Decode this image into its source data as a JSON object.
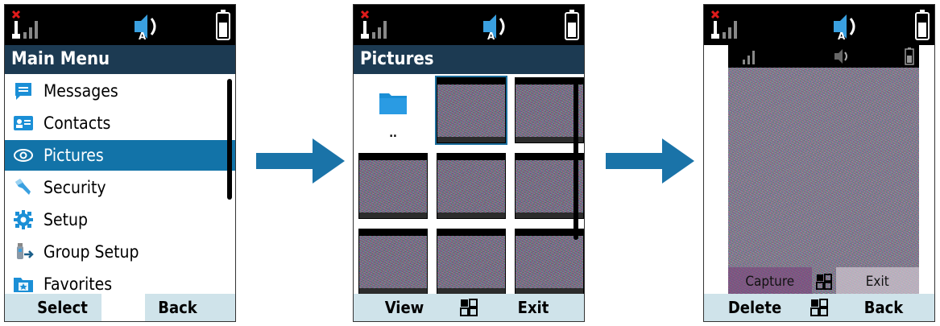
{
  "screen1": {
    "title": "Main Menu",
    "items": [
      {
        "label": "Messages",
        "icon": "messages-icon"
      },
      {
        "label": "Contacts",
        "icon": "contacts-icon"
      },
      {
        "label": "Pictures",
        "icon": "eye-icon",
        "selected": true
      },
      {
        "label": "Security",
        "icon": "key-icon"
      },
      {
        "label": "Setup",
        "icon": "gear-icon"
      },
      {
        "label": "Group Setup",
        "icon": "group-setup-icon"
      },
      {
        "label": "Favorites",
        "icon": "favorites-folder-icon"
      }
    ],
    "softkeys": {
      "left": "Select",
      "right": "Back"
    }
  },
  "screen2": {
    "title": "Pictures",
    "folder_label": "..",
    "softkeys": {
      "left": "View",
      "right": "Exit"
    }
  },
  "screen3": {
    "preview_softkeys": {
      "left": "Capture",
      "right": "Exit"
    },
    "softkeys": {
      "left": "Delete",
      "right": "Back"
    }
  },
  "colors": {
    "title_bar": "#1c3a52",
    "selection": "#1273a8",
    "softkey_bar": "#cfe3ea",
    "arrow": "#1a73a8"
  }
}
